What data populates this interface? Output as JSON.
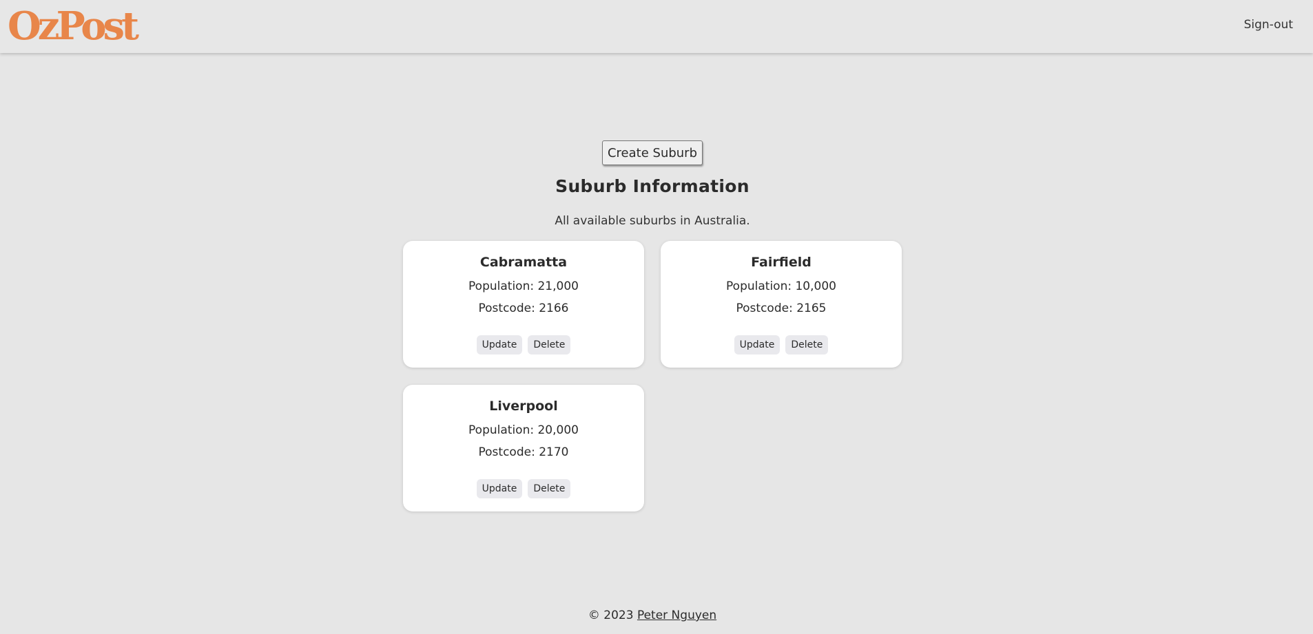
{
  "header": {
    "logo_text": "OzPost",
    "signout_label": "Sign-out"
  },
  "main": {
    "create_button_label": "Create Suburb",
    "title": "Suburb Information",
    "subtitle": "All available suburbs in Australia.",
    "suburbs": [
      {
        "name": "Cabramatta",
        "population": "Population: 21,000",
        "postcode": "Postcode: 2166",
        "update_label": "Update",
        "delete_label": "Delete"
      },
      {
        "name": "Fairfield",
        "population": "Population: 10,000",
        "postcode": "Postcode: 2165",
        "update_label": "Update",
        "delete_label": "Delete"
      },
      {
        "name": "Liverpool",
        "population": "Population: 20,000",
        "postcode": "Postcode: 2170",
        "update_label": "Update",
        "delete_label": "Delete"
      }
    ]
  },
  "footer": {
    "copyright": "© 2023",
    "author_link": "Peter Nguyen"
  },
  "colors": {
    "brand": "#e8864a",
    "background": "#e6e6e6",
    "card": "#ffffff"
  }
}
